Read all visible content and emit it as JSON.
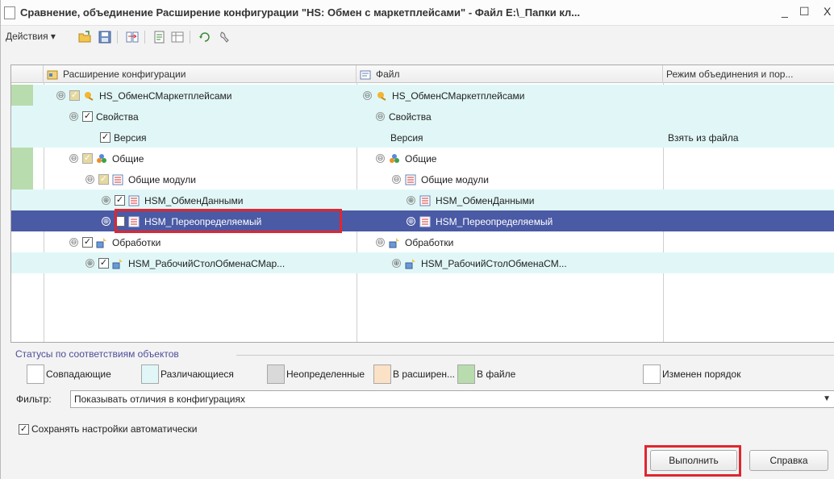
{
  "window": {
    "title": "Сравнение, объединение Расширение конфигурации \"HS: Обмен с маркетплейсами\" - Файл E:\\_Папки кл...",
    "minimize_glyph": "_",
    "maximize_glyph": "☐",
    "close_glyph": "X"
  },
  "toolbar": {
    "actions_label": "Действия",
    "dropdown_glyph": "▾",
    "icons": [
      "open-icon",
      "save-icon",
      "compare-icon",
      "report-icon",
      "refresh-icon",
      "settings-icon"
    ]
  },
  "grid": {
    "columns": [
      {
        "label": "Расширение конфигурации",
        "icon": "extension-icon"
      },
      {
        "label": "Файл",
        "icon": "file-icon"
      },
      {
        "label": "Режим объединения и пор..."
      }
    ],
    "rows": [
      {
        "left": "HS_ОбменСМаркетплейсами",
        "right": "HS_ОбменСМаркетплейсами",
        "mode": "",
        "expander": "⊖",
        "left_check": "partial",
        "icon": "config-icon"
      },
      {
        "left": "Свойства",
        "right": "Свойства",
        "mode": "",
        "expander": "⊖",
        "left_check": "checked",
        "icon": ""
      },
      {
        "left": "Версия",
        "right": "Версия",
        "mode": "Взять из файла",
        "expander": "",
        "left_check": "checked",
        "icon": ""
      },
      {
        "left": "Общие",
        "right": "Общие",
        "mode": "",
        "expander": "⊖",
        "left_check": "partial",
        "icon": "common-icon"
      },
      {
        "left": "Общие модули",
        "right": "Общие модули",
        "mode": "",
        "expander": "⊖",
        "left_check": "partial",
        "icon": "module-icon"
      },
      {
        "left": "HSM_ОбменДанными",
        "right": "HSM_ОбменДанными",
        "mode": "",
        "expander": "⊕",
        "left_check": "checked",
        "icon": "module-icon"
      },
      {
        "left": "HSM_Переопределяемый",
        "right": "HSM_Переопределяемый",
        "mode": "",
        "expander": "⊕",
        "left_check": "unchecked",
        "icon": "module-icon"
      },
      {
        "left": "Обработки",
        "right": "Обработки",
        "mode": "",
        "expander": "⊖",
        "left_check": "checked",
        "icon": "processing-icon"
      },
      {
        "left": "HSM_РабочийСтолОбменаСМар...",
        "right": "HSM_РабочийСтолОбменаСМ...",
        "mode": "",
        "expander": "⊕",
        "left_check": "checked",
        "icon": "processing-icon"
      }
    ]
  },
  "statuses": {
    "title": "Статусы по соответствиям объектов",
    "items": [
      {
        "label": "Совпадающие",
        "color": "#ffffff"
      },
      {
        "label": "Различающиеся",
        "color": "#e1f7f7"
      },
      {
        "label": "Неопределенные",
        "color": "#d9d9d9"
      },
      {
        "label": "В расширен...",
        "color": "#fbe1c6"
      },
      {
        "label": "В файле",
        "color": "#b9dcae"
      },
      {
        "label": "Изменен порядок",
        "color": "#ffffff"
      }
    ]
  },
  "filter": {
    "label": "Фильтр:",
    "value": "Показывать отличия в конфигурациях"
  },
  "save_settings": {
    "label": "Сохранять настройки автоматически",
    "checked": true
  },
  "buttons": {
    "execute": "Выполнить",
    "help": "Справка"
  },
  "colors": {
    "selection": "#4a5aa5",
    "differing_row": "#e1f7f7",
    "in_file_mark": "#b9dcae",
    "highlight": "#e0262e"
  }
}
